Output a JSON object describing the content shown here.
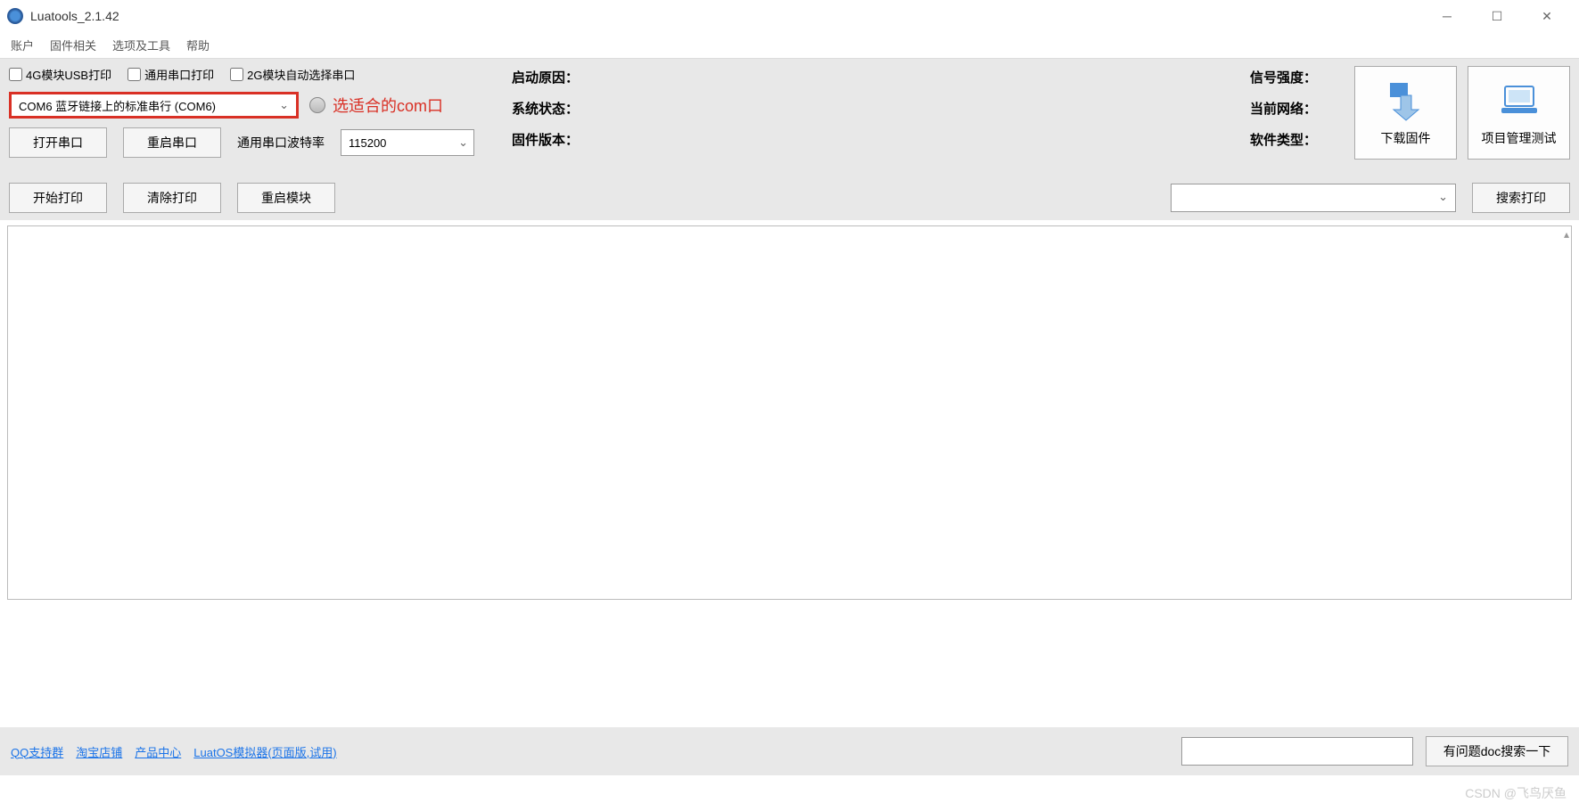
{
  "window": {
    "title": "Luatools_2.1.42"
  },
  "menubar": {
    "account": "账户",
    "firmware": "固件相关",
    "options": "选项及工具",
    "help": "帮助"
  },
  "checkboxes": {
    "usb_print": "4G模块USB打印",
    "generic_serial": "通用串口打印",
    "auto_2g": "2G模块自动选择串口"
  },
  "com_select": {
    "value": "COM6 蓝牙链接上的标准串行 (COM6)",
    "annotation": "选适合的com口"
  },
  "buttons": {
    "open_serial": "打开串口",
    "restart_serial": "重启串口",
    "start_print": "开始打印",
    "clear_print": "清除打印",
    "restart_module": "重启模块",
    "search_print": "搜索打印",
    "download_fw": "下载固件",
    "project_test": "项目管理测试",
    "doc_search": "有问题doc搜索一下"
  },
  "baud": {
    "label": "通用串口波特率",
    "value": "115200"
  },
  "info": {
    "boot_reason": "启动原因：",
    "system_status": "系统状态：",
    "fw_version": "固件版本：",
    "signal": "信号强度：",
    "network": "当前网络：",
    "sw_type": "软件类型："
  },
  "links": {
    "qq": "QQ支持群",
    "taobao": "淘宝店铺",
    "product": "产品中心",
    "simulator": "LuatOS模拟器(页面版,试用)"
  },
  "watermark": "CSDN @飞鸟厌鱼"
}
